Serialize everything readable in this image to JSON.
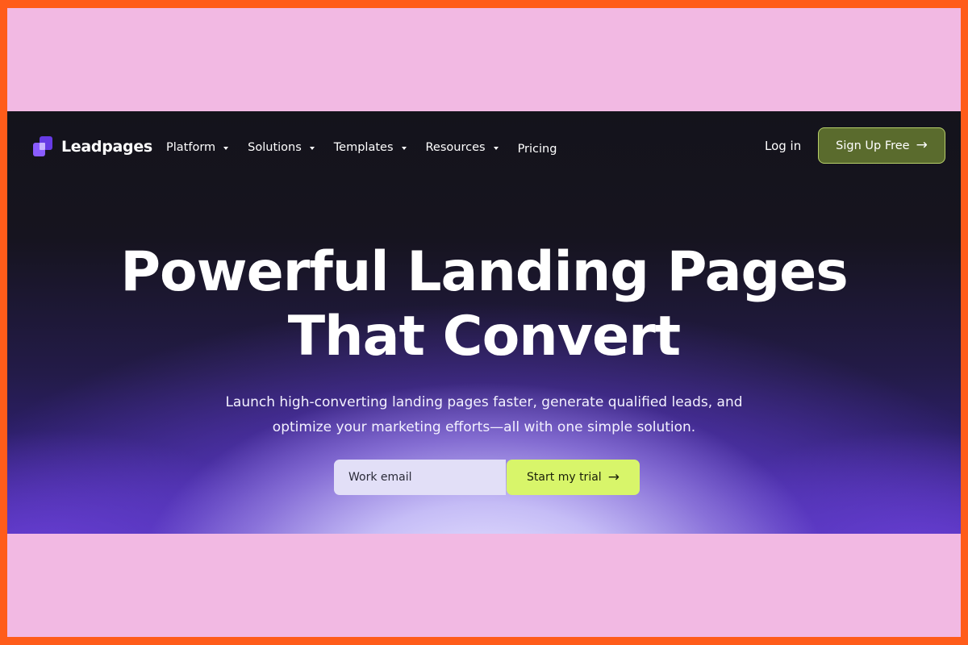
{
  "brand": {
    "name": "Leadpages"
  },
  "nav": {
    "items": [
      {
        "label": "Platform",
        "has_dropdown": true
      },
      {
        "label": "Solutions",
        "has_dropdown": true
      },
      {
        "label": "Templates",
        "has_dropdown": true
      },
      {
        "label": "Resources",
        "has_dropdown": true
      },
      {
        "label": "Pricing",
        "has_dropdown": false
      }
    ],
    "login_label": "Log in",
    "signup_label": "Sign Up Free"
  },
  "hero": {
    "title_line1": "Powerful Landing Pages",
    "title_line2": "That Convert",
    "subtitle_line1": "Launch high-converting landing pages faster, generate qualified leads, and",
    "subtitle_line2": "optimize your marketing efforts—all with one simple solution.",
    "email_placeholder": "Work email",
    "cta_label": "Start my trial"
  },
  "colors": {
    "outer_border": "#ff5c1a",
    "inner_frame": "#f2b9e3",
    "page_bg": "#14131b",
    "signup_bg": "#5a6b2d",
    "cta_bg": "#d8f56a",
    "brand_purple": "#8a5cff"
  },
  "icons": {
    "dropdown": "chevron-down-icon",
    "arrow": "arrow-right-icon",
    "logo": "leadpages-logo-icon"
  }
}
